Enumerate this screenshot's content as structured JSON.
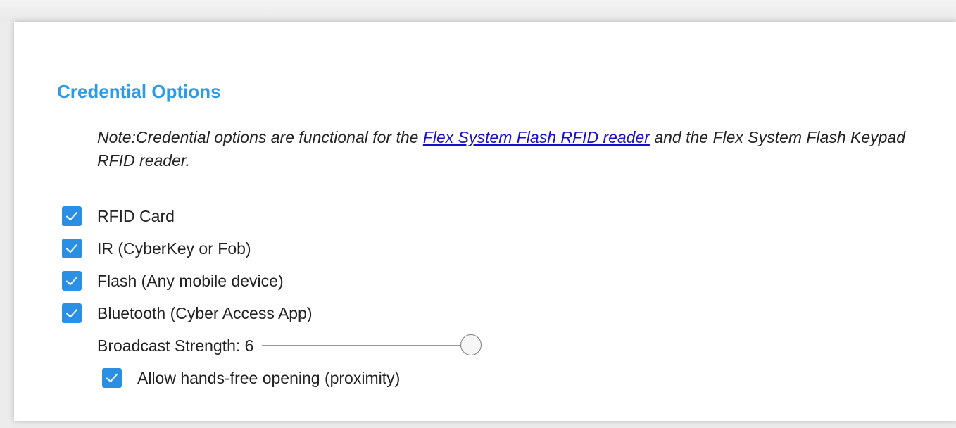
{
  "section": {
    "title": "Credential Options"
  },
  "note": {
    "prefix": "Note:Credential options are functional for the ",
    "link_text": "Flex System Flash RFID reader",
    "suffix": " and the Flex System Flash Keypad RFID reader."
  },
  "options": [
    {
      "label": "RFID Card",
      "checked": true
    },
    {
      "label": "IR (CyberKey or Fob)",
      "checked": true
    },
    {
      "label": "Flash (Any mobile device)",
      "checked": true
    },
    {
      "label": "Bluetooth (Cyber Access App)",
      "checked": true
    }
  ],
  "broadcast": {
    "label": "Broadcast Strength: 6",
    "value": 6,
    "min": 1,
    "max": 6
  },
  "hands_free": {
    "label": "Allow hands-free opening (proximity)",
    "checked": true
  },
  "colors": {
    "title": "#2f9be6",
    "checkbox": "#2b8fe3",
    "link": "#1a0dcc"
  },
  "icons": {
    "checkbox": "checkmark-icon",
    "slider_thumb": "circle-handle"
  }
}
